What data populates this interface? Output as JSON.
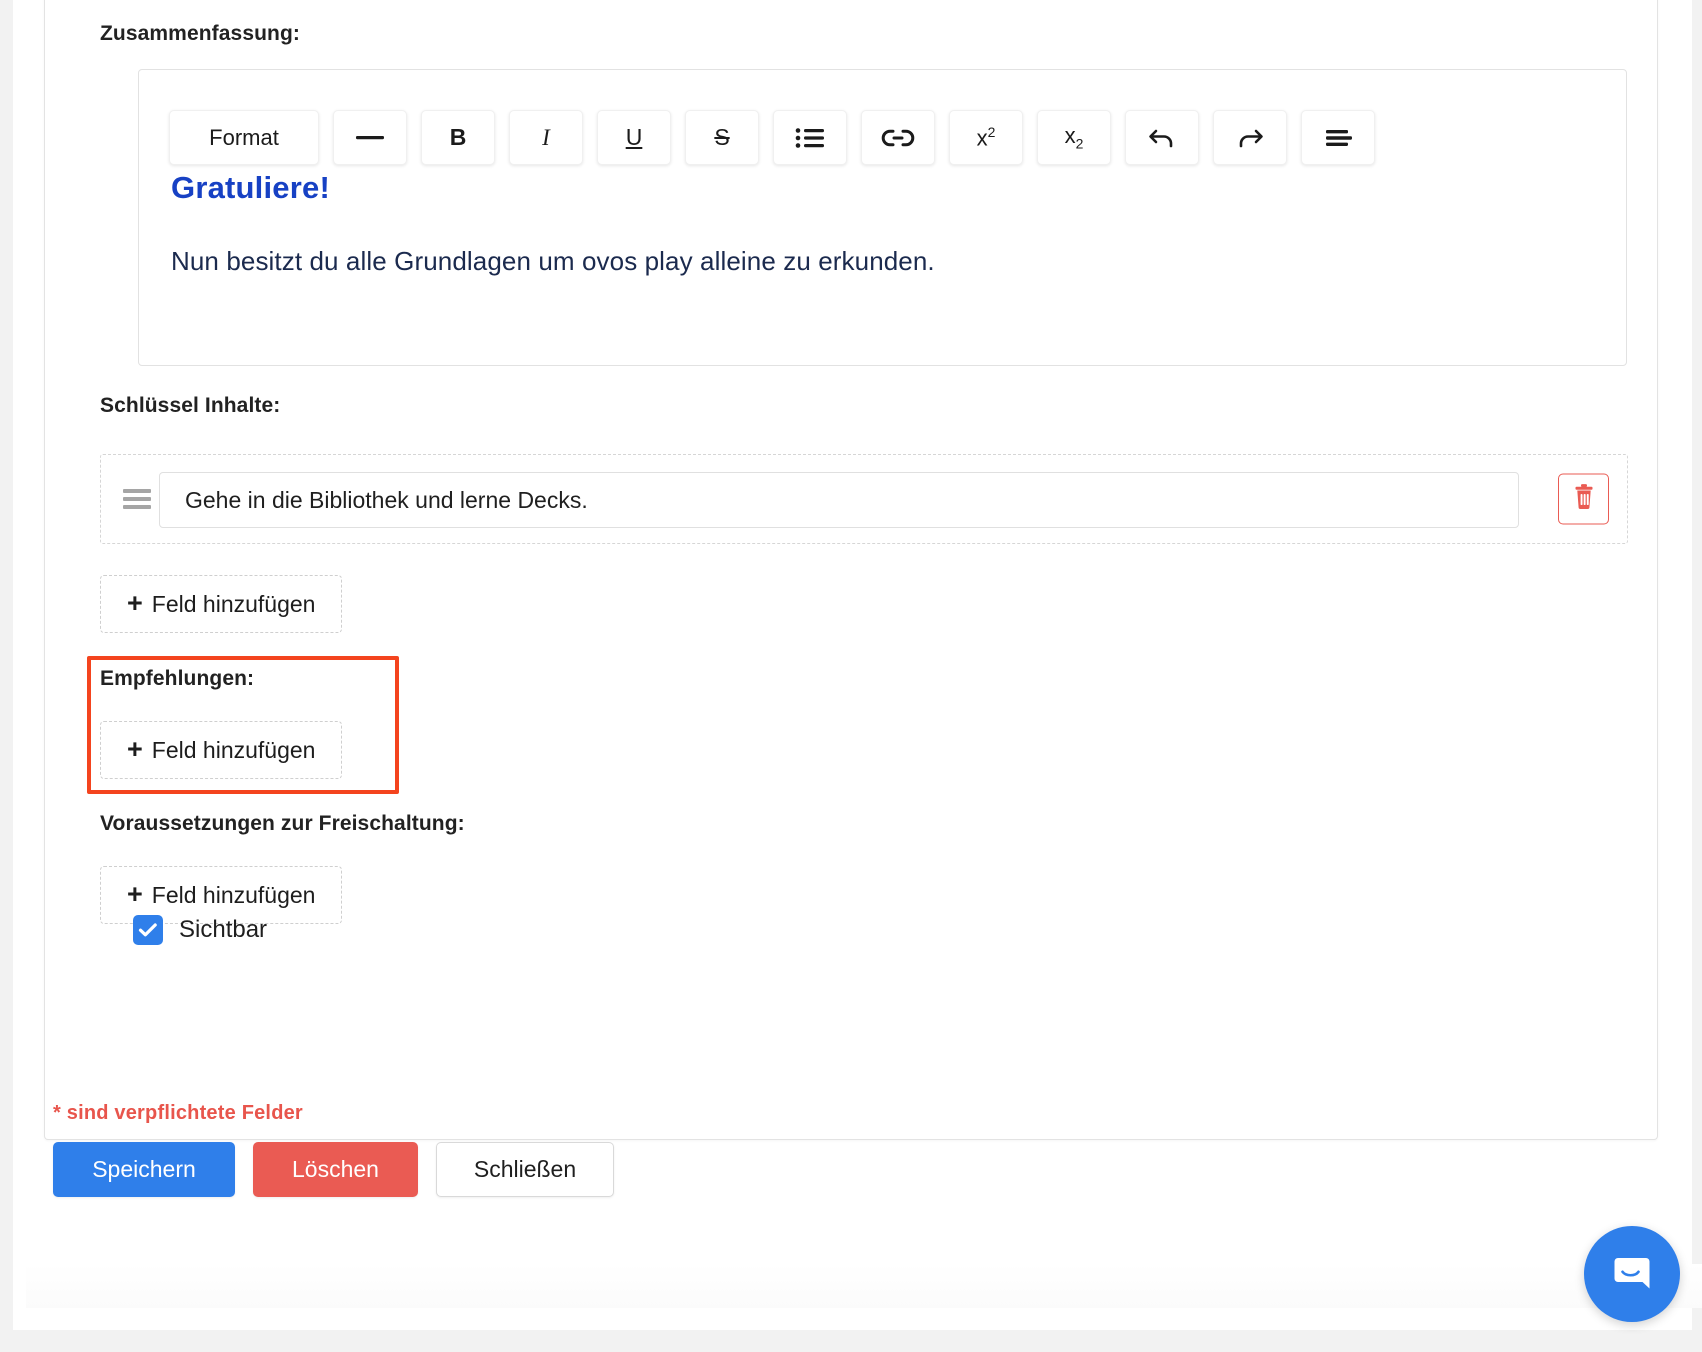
{
  "labels": {
    "summary": "Zusammenfassung:",
    "key_contents": "Schlüssel Inhalte:",
    "recommendations": "Empfehlungen:",
    "unlock_requirements": "Voraussetzungen zur Freischaltung:"
  },
  "editor": {
    "toolbar": [
      {
        "name": "format",
        "label": "Format",
        "icon": "text"
      },
      {
        "name": "horizontal-rule",
        "label": "—",
        "icon": "dash"
      },
      {
        "name": "bold",
        "label": "B",
        "icon": "bold"
      },
      {
        "name": "italic",
        "label": "I",
        "icon": "italic"
      },
      {
        "name": "underline",
        "label": "U",
        "icon": "underline"
      },
      {
        "name": "strikethrough",
        "label": "S",
        "icon": "strikethrough"
      },
      {
        "name": "bullet-list",
        "label": "",
        "icon": "list-icon"
      },
      {
        "name": "link",
        "label": "",
        "icon": "link-icon"
      },
      {
        "name": "superscript",
        "label": "x2",
        "icon": "superscript"
      },
      {
        "name": "subscript",
        "label": "x2",
        "icon": "subscript"
      },
      {
        "name": "undo",
        "label": "",
        "icon": "undo-icon"
      },
      {
        "name": "redo",
        "label": "",
        "icon": "redo-icon"
      },
      {
        "name": "align",
        "label": "",
        "icon": "align-icon"
      }
    ],
    "content": {
      "heading": "Gratuliere!",
      "paragraph": "Nun besitzt du alle Grundlagen um ovos play alleine zu erkunden.",
      "heading_color": "#1741c4",
      "paragraph_color": "#1b2a4e"
    }
  },
  "key_contents": {
    "rows": [
      {
        "value": "Gehe in die Bibliothek und lerne Decks.",
        "placeholder": ""
      }
    ],
    "add_label": "Feld hinzufügen"
  },
  "recommendations": {
    "add_label": "Feld hinzufügen"
  },
  "unlock_requirements": {
    "add_label": "Feld hinzufügen"
  },
  "visible_checkbox": {
    "label": "Sichtbar",
    "checked": true,
    "accent": "#2f7fea"
  },
  "footer": {
    "required_note": "* sind verpflichtete Felder",
    "save_label": "Speichern",
    "delete_label": "Löschen",
    "close_label": "Schließen",
    "save_color": "#2f7fea",
    "delete_color": "#ea5b53"
  },
  "highlight": {
    "color": "#f4441e"
  },
  "chat": {
    "name": "messenger-launcher",
    "color": "#2f7fea"
  }
}
